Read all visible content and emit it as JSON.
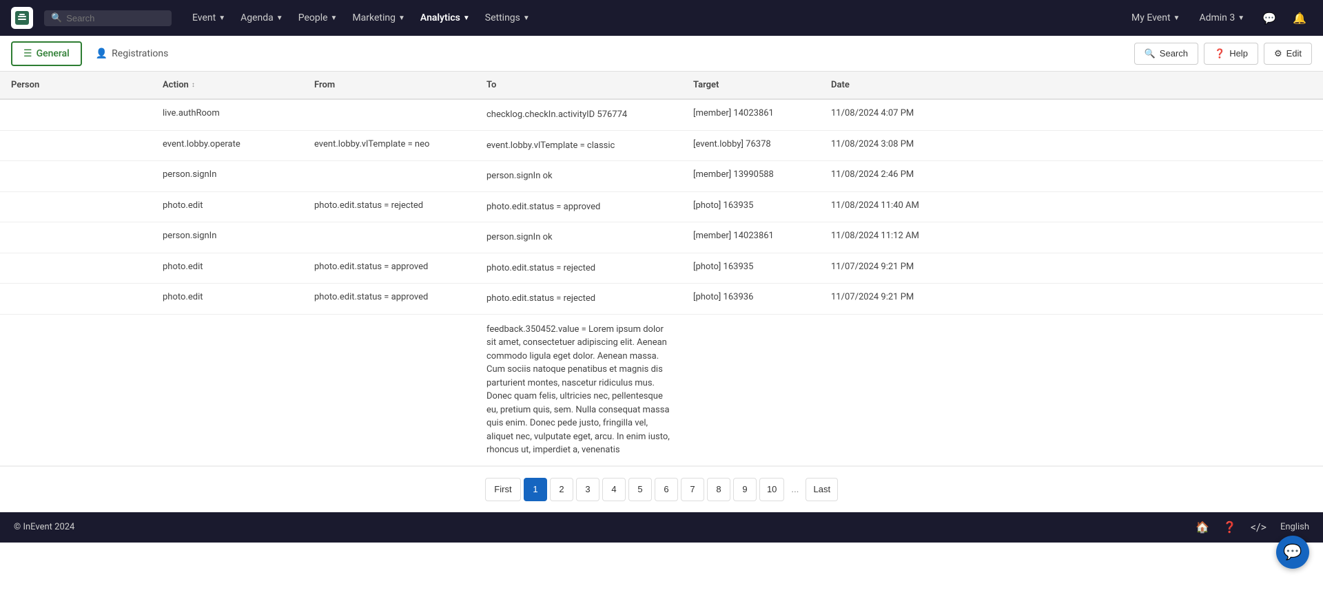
{
  "app": {
    "logo_alt": "InEvent"
  },
  "nav": {
    "search_placeholder": "Search",
    "items": [
      {
        "label": "Event",
        "has_dropdown": true
      },
      {
        "label": "Agenda",
        "has_dropdown": true
      },
      {
        "label": "People",
        "has_dropdown": true
      },
      {
        "label": "Marketing",
        "has_dropdown": true
      },
      {
        "label": "Analytics",
        "has_dropdown": true,
        "active": true
      },
      {
        "label": "Settings",
        "has_dropdown": true
      }
    ],
    "right": [
      {
        "label": "My Event",
        "has_dropdown": true
      },
      {
        "label": "Admin 3",
        "has_dropdown": true
      }
    ],
    "icon_chat": "💬",
    "icon_bell": "🔔"
  },
  "sub_nav": {
    "tabs": [
      {
        "id": "general",
        "label": "General",
        "icon": "☰",
        "active": true
      },
      {
        "id": "registrations",
        "label": "Registrations",
        "icon": "👤",
        "active": false
      }
    ],
    "buttons": [
      {
        "id": "search",
        "label": "Search",
        "icon": "🔍"
      },
      {
        "id": "help",
        "label": "Help",
        "icon": "❓"
      },
      {
        "id": "edit",
        "label": "Edit",
        "icon": "⚙"
      }
    ]
  },
  "table": {
    "columns": [
      {
        "id": "person",
        "label": "Person"
      },
      {
        "id": "action",
        "label": "Action",
        "sortable": true
      },
      {
        "id": "from",
        "label": "From"
      },
      {
        "id": "to",
        "label": "To"
      },
      {
        "id": "target",
        "label": "Target"
      },
      {
        "id": "date",
        "label": "Date"
      }
    ],
    "rows": [
      {
        "person": "",
        "action": "live.authRoom",
        "from": "",
        "to": "checklog.checkIn.activityID 576774",
        "target": "[member] 14023861",
        "date": "11/08/2024 4:07 PM"
      },
      {
        "person": "",
        "action": "event.lobby.operate",
        "from": "event.lobby.vlTemplate = neo",
        "to": "event.lobby.vlTemplate = classic",
        "target": "[event.lobby] 76378",
        "date": "11/08/2024 3:08 PM"
      },
      {
        "person": "",
        "action": "person.signIn",
        "from": "",
        "to": "person.signIn ok",
        "target": "[member] 13990588",
        "date": "11/08/2024 2:46 PM"
      },
      {
        "person": "",
        "action": "photo.edit",
        "from": "photo.edit.status = rejected",
        "to": "photo.edit.status = approved",
        "target": "[photo] 163935",
        "date": "11/08/2024 11:40 AM"
      },
      {
        "person": "",
        "action": "person.signIn",
        "from": "",
        "to": "person.signIn ok",
        "target": "[member] 14023861",
        "date": "11/08/2024 11:12 AM"
      },
      {
        "person": "",
        "action": "photo.edit",
        "from": "photo.edit.status = approved",
        "to": "photo.edit.status = rejected",
        "target": "[photo] 163935",
        "date": "11/07/2024 9:21 PM"
      },
      {
        "person": "",
        "action": "photo.edit",
        "from": "photo.edit.status = approved",
        "to": "photo.edit.status = rejected",
        "target": "[photo] 163936",
        "date": "11/07/2024 9:21 PM"
      },
      {
        "person": "",
        "action": "",
        "from": "",
        "to": "feedback.350452.value = Lorem ipsum dolor sit amet, consectetuer adipiscing elit. Aenean commodo ligula eget dolor. Aenean massa. Cum sociis natoque penatibus et magnis dis parturient montes, nascetur ridiculus mus. Donec quam felis, ultricies nec, pellentesque eu, pretium quis, sem. Nulla consequat massa quis enim. Donec pede justo, fringilla vel, aliquet nec, vulputate eget, arcu. In enim iusto, rhoncus ut, imperdiet a, venenatis",
        "target": "",
        "date": ""
      }
    ]
  },
  "pagination": {
    "first_label": "First",
    "last_label": "Last",
    "ellipsis": "...",
    "pages": [
      "1",
      "2",
      "3",
      "4",
      "5",
      "6",
      "7",
      "8",
      "9",
      "10"
    ],
    "current_page": "1"
  },
  "footer": {
    "copyright": "© InEvent 2024",
    "language": "English"
  },
  "chat_fab_icon": "💬"
}
